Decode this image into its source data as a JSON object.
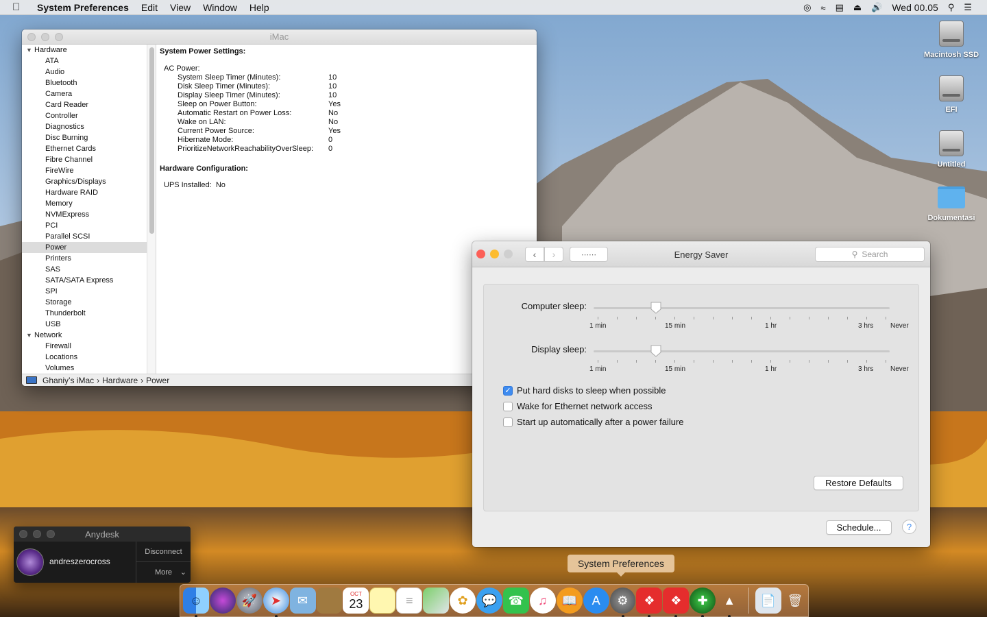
{
  "menubar": {
    "app_name": "System Preferences",
    "menus": [
      "Edit",
      "View",
      "Window",
      "Help"
    ],
    "clock": "Wed 00.05"
  },
  "desktop_icons": [
    {
      "label": "Macintosh SSD",
      "icon": "drive-icon"
    },
    {
      "label": "EFI",
      "icon": "drive-icon"
    },
    {
      "label": "Untitled",
      "icon": "drive-icon"
    },
    {
      "label": "Dokumentasi",
      "icon": "folder-icon"
    }
  ],
  "sysinfo": {
    "title": "iMac",
    "groups": [
      {
        "label": "Hardware",
        "items": [
          "ATA",
          "Audio",
          "Bluetooth",
          "Camera",
          "Card Reader",
          "Controller",
          "Diagnostics",
          "Disc Burning",
          "Ethernet Cards",
          "Fibre Channel",
          "FireWire",
          "Graphics/Displays",
          "Hardware RAID",
          "Memory",
          "NVMExpress",
          "PCI",
          "Parallel SCSI",
          "Power",
          "Printers",
          "SAS",
          "SATA/SATA Express",
          "SPI",
          "Storage",
          "Thunderbolt",
          "USB"
        ]
      },
      {
        "label": "Network",
        "items": [
          "Firewall",
          "Locations",
          "Volumes"
        ]
      }
    ],
    "selected_item": "Power",
    "section1_title": "System Power Settings:",
    "ac_power_label": "AC Power:",
    "ac_power": [
      {
        "k": "System Sleep Timer (Minutes):",
        "v": "10"
      },
      {
        "k": "Disk Sleep Timer (Minutes):",
        "v": "10"
      },
      {
        "k": "Display Sleep Timer (Minutes):",
        "v": "10"
      },
      {
        "k": "Sleep on Power Button:",
        "v": "Yes"
      },
      {
        "k": "Automatic Restart on Power Loss:",
        "v": "No"
      },
      {
        "k": "Wake on LAN:",
        "v": "No"
      },
      {
        "k": "Current Power Source:",
        "v": "Yes"
      },
      {
        "k": "Hibernate Mode:",
        "v": "0"
      },
      {
        "k": "PrioritizeNetworkReachabilityOverSleep:",
        "v": "0"
      }
    ],
    "section2_title": "Hardware Configuration:",
    "ups_label": "UPS Installed:",
    "ups_value": "No",
    "path": [
      "Ghaniy’s iMac",
      "Hardware",
      "Power"
    ]
  },
  "energy": {
    "title": "Energy Saver",
    "search_placeholder": "Search",
    "computer_sleep_label": "Computer sleep:",
    "display_sleep_label": "Display sleep:",
    "tick_labels": [
      "1 min",
      "15 min",
      "1 hr",
      "3 hrs",
      "Never"
    ],
    "computer_sleep_level": 0.21,
    "display_sleep_level": 0.21,
    "checkboxes": [
      {
        "label": "Put hard disks to sleep when possible",
        "checked": true
      },
      {
        "label": "Wake for Ethernet network access",
        "checked": false
      },
      {
        "label": "Start up automatically after a power failure",
        "checked": false
      }
    ],
    "restore_label": "Restore Defaults",
    "schedule_label": "Schedule...",
    "help_label": "?"
  },
  "anydesk": {
    "title": "Anydesk",
    "user": "andreszerocross",
    "disconnect_label": "Disconnect",
    "more_label": "More"
  },
  "dock": {
    "tooltip": "System Preferences",
    "calendar_day": "23",
    "calendar_month": "OCT"
  }
}
